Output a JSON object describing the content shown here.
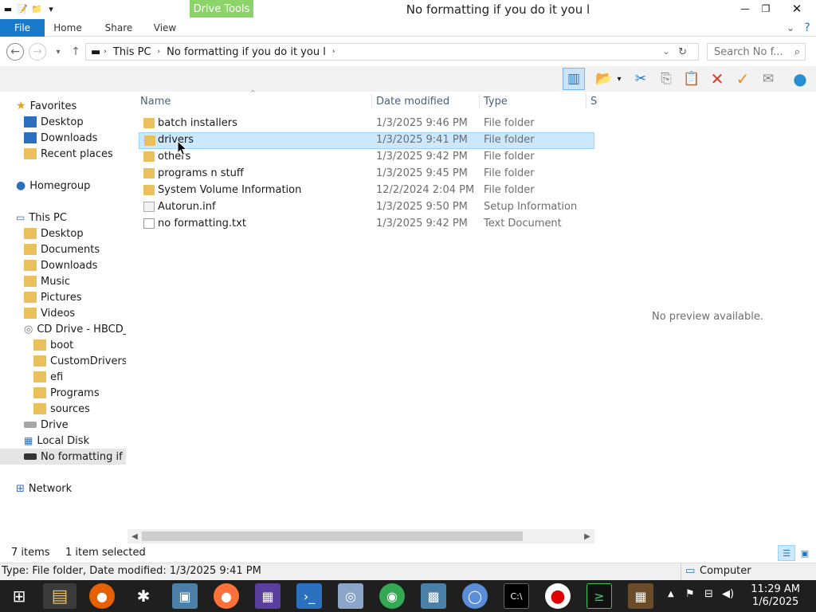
{
  "titlebar": {
    "context_tab": "Drive Tools",
    "window_title": "No formatting if you do it you l"
  },
  "ribbon": {
    "tabs": [
      "File",
      "Home",
      "Share",
      "View"
    ]
  },
  "address": {
    "breadcrumb": [
      "This PC",
      "No formatting if you do it you l"
    ],
    "search_placeholder": "Search No f..."
  },
  "nav": {
    "favorites": "Favorites",
    "fav_items": [
      "Desktop",
      "Downloads",
      "Recent places"
    ],
    "homegroup": "Homegroup",
    "thispc": "This PC",
    "pc_items": [
      "Desktop",
      "Documents",
      "Downloads",
      "Music",
      "Pictures",
      "Videos",
      "CD Drive - HBCD_"
    ],
    "cd_items": [
      "boot",
      "CustomDrivers",
      "efi",
      "Programs",
      "sources"
    ],
    "drive": "Drive",
    "localdisk": "Local Disk",
    "current": "No formatting if y",
    "network": "Network"
  },
  "columns": {
    "name": "Name",
    "date": "Date modified",
    "type": "Type",
    "size": "S"
  },
  "files": [
    {
      "name": "batch installers",
      "date": "1/3/2025 9:46 PM",
      "type": "File folder"
    },
    {
      "name": "drivers",
      "date": "1/3/2025 9:41 PM",
      "type": "File folder"
    },
    {
      "name": "others",
      "date": "1/3/2025 9:42 PM",
      "type": "File folder"
    },
    {
      "name": "programs n stuff",
      "date": "1/3/2025 9:45 PM",
      "type": "File folder"
    },
    {
      "name": "System Volume Information",
      "date": "12/2/2024 2:04 PM",
      "type": "File folder"
    },
    {
      "name": "Autorun.inf",
      "date": "1/3/2025 9:50 PM",
      "type": "Setup Information"
    },
    {
      "name": "no formatting.txt",
      "date": "1/3/2025 9:42 PM",
      "type": "Text Document"
    }
  ],
  "preview_text": "No preview available.",
  "status": {
    "items": "7 items",
    "selected": "1 item selected",
    "details": "Type: File folder, Date modified: 1/3/2025 9:41 PM",
    "location": "Computer"
  },
  "clock": {
    "time": "11:29 AM",
    "date": "1/6/2025"
  },
  "colors": {
    "file_tab": "#1979ca",
    "drive_tools": "#8bd46a",
    "selection": "#cce8ff",
    "taskbar": "#1f1f1f"
  }
}
